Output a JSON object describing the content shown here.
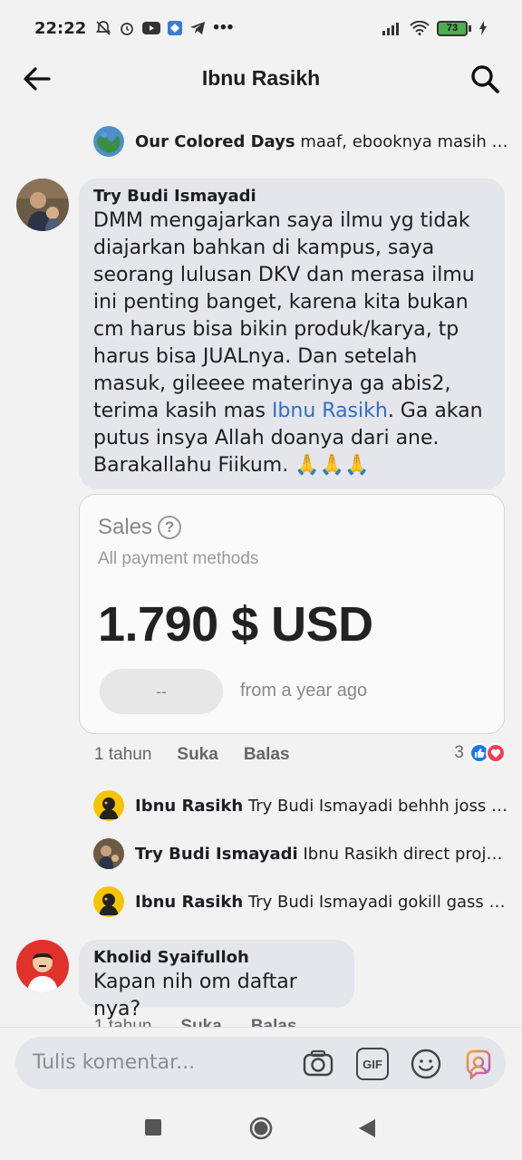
{
  "status_bar": {
    "time": "22:22",
    "battery": "73",
    "left_icons": [
      "mute-bell-icon",
      "alarm-icon",
      "youtube-icon",
      "app-icon",
      "telegram-icon",
      "more-dots-icon"
    ],
    "right_icons": [
      "signal-icon",
      "wifi-icon",
      "battery-icon",
      "charging-icon"
    ]
  },
  "header": {
    "title": "Ibnu Rasikh"
  },
  "top_reply": {
    "name": "Our Colored Days",
    "text": "maaf, ebooknya masih ad..."
  },
  "main_comment": {
    "name": "Try Budi Ismayadi",
    "text_before": "DMM mengajarkan saya ilmu yg tidak diajarkan bahkan di kampus, saya seorang lulusan DKV dan merasa ilmu ini penting banget, karena kita bukan cm harus bisa bikin produk/karya, tp harus bisa JUALnya. Dan setelah masuk, gileeee materinya ga abis2, terima kasih mas ",
    "mention": "Ibnu Rasikh",
    "text_after": ". Ga akan putus insya Allah doanya dari ane. Barakallahu Fiikum. 🙏🙏🙏",
    "time": "1 tahun",
    "like_label": "Suka",
    "reply_label": "Balas",
    "reaction_count": "3"
  },
  "attachment": {
    "title": "Sales",
    "help": "?",
    "subtitle": "All payment methods",
    "value": "1.790 $ USD",
    "pill": "--",
    "from": "from a year ago"
  },
  "replies": [
    {
      "name": "Ibnu Rasikh",
      "text": "Try Budi Ismayadi behhh joss iki..."
    },
    {
      "name": "Try Budi Ismayadi",
      "text": "Ibnu Rasikh direct project..."
    },
    {
      "name": "Ibnu Rasikh",
      "text": "Try Budi Ismayadi gokill gass m..."
    }
  ],
  "second_comment": {
    "name": "Kholid Syaifulloh",
    "text": "Kapan nih om daftar nya?",
    "time": "1 tahun",
    "like_label": "Suka",
    "reply_label": "Balas"
  },
  "composer": {
    "placeholder": "Tulis komentar...",
    "gif_label": "GIF"
  },
  "colors": {
    "background": "#f2f2f2",
    "bubble": "#e4e6eb",
    "mention": "#2f6ec6",
    "like": "#1877f2",
    "love": "#f33e58"
  }
}
